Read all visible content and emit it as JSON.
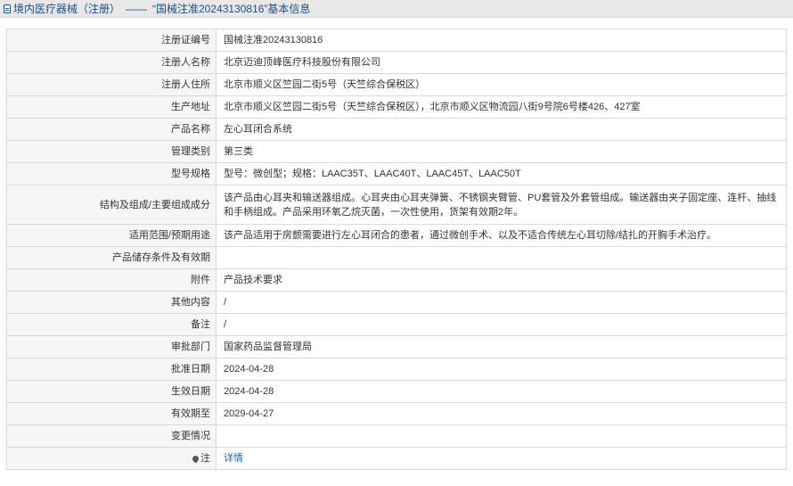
{
  "header": {
    "category": "境内医疗器械（注册）",
    "separator": "——",
    "record_title": "“国械注准20243130816”基本信息"
  },
  "rows": [
    {
      "label": "注册证编号",
      "value": "国械注准20243130816"
    },
    {
      "label": "注册人名称",
      "value": "北京迈迪顶峰医疗科技股份有限公司"
    },
    {
      "label": "注册人住所",
      "value": "北京市顺义区竺园二街5号（天竺综合保税区）"
    },
    {
      "label": "生产地址",
      "value": "北京市顺义区竺园二街5号（天竺综合保税区），北京市顺义区物流园八街9号院6号楼426、427室"
    },
    {
      "label": "产品名称",
      "value": "左心耳闭合系统"
    },
    {
      "label": "管理类别",
      "value": "第三类"
    },
    {
      "label": "型号规格",
      "value": "型号：微创型；规格：LAAC35T、LAAC40T、LAAC45T、LAAC50T"
    },
    {
      "label": "结构及组成/主要组成成分",
      "value": "该产品由心耳夹和输送器组成。心耳夹由心耳夹弹簧、不锈钢夹臂管、PU套管及外套管组成。输送器由夹子固定座、连杆、抽线和手柄组成。产品采用环氧乙烷灭菌，一次性使用，货架有效期2年。"
    },
    {
      "label": "适用范围/预期用途",
      "value": "该产品适用于房颤需要进行左心耳闭合的患者，通过微创手术、以及不适合传统左心耳切除/结扎的开胸手术治疗。"
    },
    {
      "label": "产品储存条件及有效期",
      "value": ""
    },
    {
      "label": "附件",
      "value": "产品技术要求"
    },
    {
      "label": "其他内容",
      "value": "/"
    },
    {
      "label": "备注",
      "value": "/"
    },
    {
      "label": "审批部门",
      "value": "国家药品监督管理局"
    },
    {
      "label": "批准日期",
      "value": "2024-04-28"
    },
    {
      "label": "生效日期",
      "value": "2024-04-28"
    },
    {
      "label": "有效期至",
      "value": "2029-04-27"
    },
    {
      "label": "变更情况",
      "value": ""
    }
  ],
  "note": {
    "label": "注",
    "link": "详情"
  }
}
